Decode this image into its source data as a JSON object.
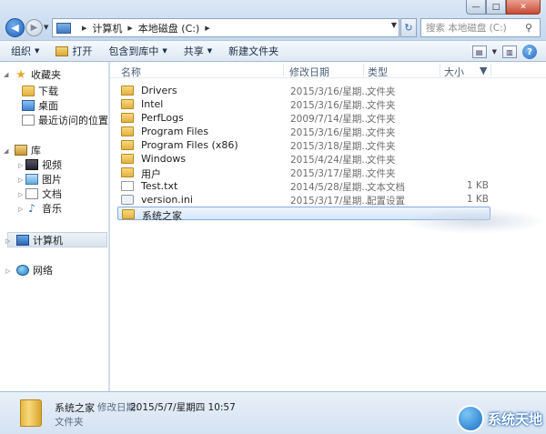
{
  "window": {
    "minimize": "—",
    "maximize": "□",
    "close": "✕"
  },
  "address": {
    "segments": [
      "计算机",
      "本地磁盘 (C:)"
    ]
  },
  "search": {
    "placeholder": "搜索 本地磁盘 (C:)"
  },
  "toolbar": {
    "organize": "组织",
    "open": "打开",
    "include_in_library": "包含到库中",
    "share": "共享",
    "new_folder": "新建文件夹"
  },
  "nav": {
    "favorites": "收藏夹",
    "downloads": "下载",
    "desktop": "桌面",
    "recent": "最近访问的位置",
    "libraries": "库",
    "videos": "视频",
    "pictures": "图片",
    "documents": "文档",
    "music": "音乐",
    "computer": "计算机",
    "network": "网络"
  },
  "columns": {
    "name": "名称",
    "date": "修改日期",
    "type": "类型",
    "size": "大小"
  },
  "files": [
    {
      "name": "Drivers",
      "date": "2015/3/16/星期...",
      "type": "文件夹",
      "size": "",
      "icon": "folder"
    },
    {
      "name": "Intel",
      "date": "2015/3/16/星期...",
      "type": "文件夹",
      "size": "",
      "icon": "folder"
    },
    {
      "name": "PerfLogs",
      "date": "2009/7/14/星期...",
      "type": "文件夹",
      "size": "",
      "icon": "folder"
    },
    {
      "name": "Program Files",
      "date": "2015/3/16/星期...",
      "type": "文件夹",
      "size": "",
      "icon": "folder"
    },
    {
      "name": "Program Files (x86)",
      "date": "2015/3/18/星期...",
      "type": "文件夹",
      "size": "",
      "icon": "folder"
    },
    {
      "name": "Windows",
      "date": "2015/4/24/星期...",
      "type": "文件夹",
      "size": "",
      "icon": "folder"
    },
    {
      "name": "用户",
      "date": "2015/3/17/星期...",
      "type": "文件夹",
      "size": "",
      "icon": "folder"
    },
    {
      "name": "Test.txt",
      "date": "2014/5/28/星期...",
      "type": "文本文档",
      "size": "1 KB",
      "icon": "file"
    },
    {
      "name": "version.ini",
      "date": "2015/3/17/星期...",
      "type": "配置设置",
      "size": "1 KB",
      "icon": "ini"
    },
    {
      "name": "系统之家",
      "date": "",
      "type": "",
      "size": "",
      "icon": "folder"
    }
  ],
  "details": {
    "name": "系统之家",
    "modified_label": "修改日期:",
    "modified_value": "2015/5/7/星期四 10:57",
    "type": "文件夹"
  },
  "watermark": "系统天地"
}
